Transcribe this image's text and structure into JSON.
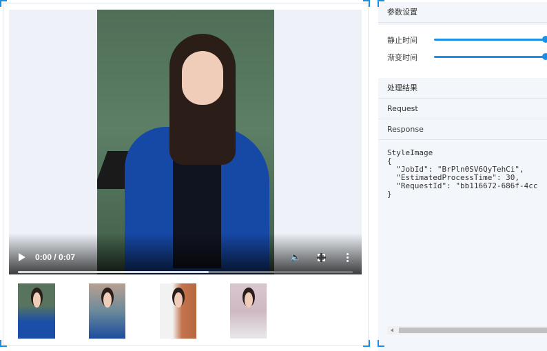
{
  "player": {
    "time_display": "0:00 / 0:07",
    "progress": 0.57
  },
  "thumbnails": [
    {
      "id": "thumb-1"
    },
    {
      "id": "thumb-2"
    },
    {
      "id": "thumb-3"
    },
    {
      "id": "thumb-4"
    }
  ],
  "panel": {
    "params_title": "参数设置",
    "params": [
      {
        "label": "静止时间",
        "value": 0.96
      },
      {
        "label": "渐变时间",
        "value": 0.96
      }
    ],
    "result_title": "处理结果",
    "request_label": "Request",
    "response_label": "Response",
    "response_code": "StyleImage\n{\n  \"JobId\": \"BrPln0SV6QyTehCi\",\n  \"EstimatedProcessTime\": 30,\n  \"RequestId\": \"bb116672-686f-4cc\n}"
  },
  "colors": {
    "accent": "#1a8fe6",
    "panel_bg": "#f3f6fa"
  }
}
